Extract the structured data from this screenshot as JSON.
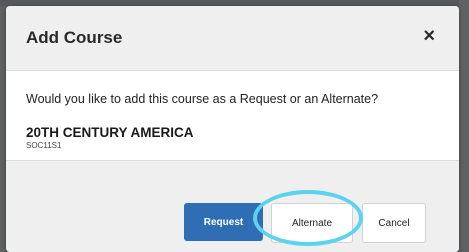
{
  "dialog": {
    "title": "Add Course",
    "close_label": "×",
    "prompt": "Would you like to add this course as a Request or an Alternate?",
    "course": {
      "name": "20TH CENTURY AMERICA",
      "code": "SOC11S1"
    },
    "buttons": {
      "request": "Request",
      "alternate": "Alternate",
      "cancel": "Cancel"
    }
  },
  "colors": {
    "primary_button": "#2f6db5",
    "highlight": "#5bd3ee",
    "backdrop": "#5f6163"
  }
}
